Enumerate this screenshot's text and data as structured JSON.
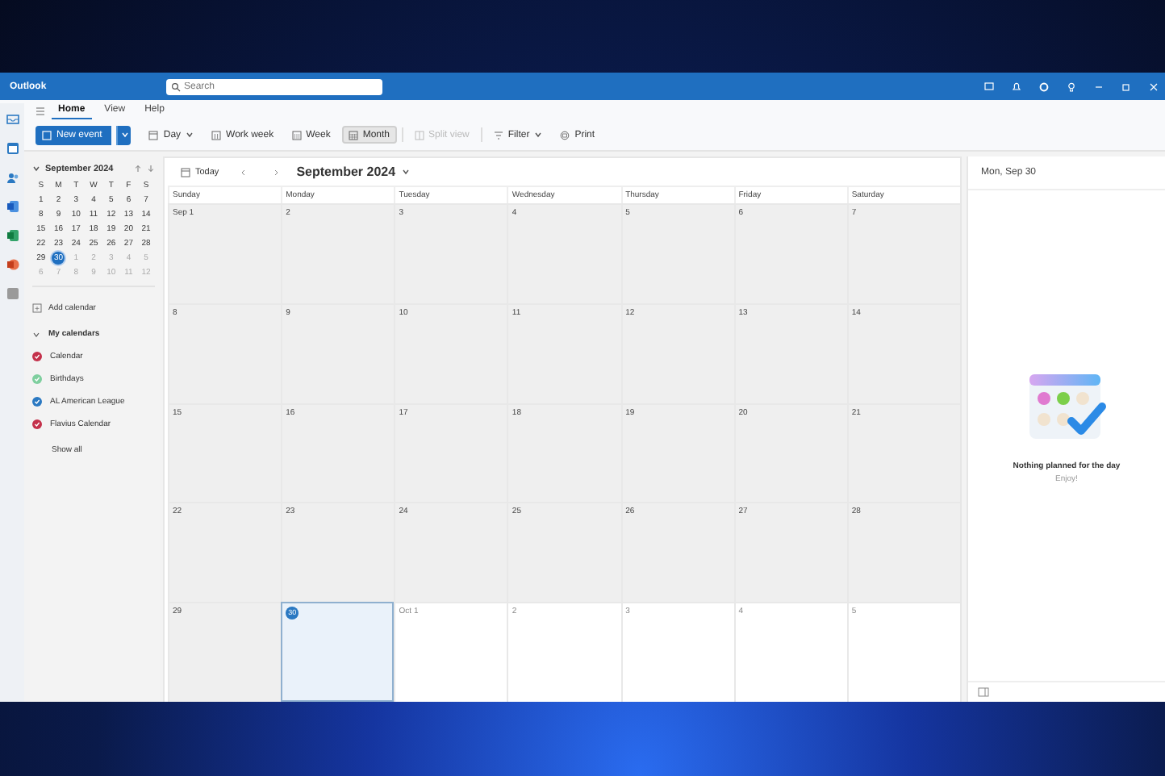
{
  "window": {
    "title": "Outlook"
  },
  "search": {
    "placeholder": "Search"
  },
  "ribbon_tabs": [
    {
      "label": "Home",
      "selected": true
    },
    {
      "label": "View",
      "selected": false
    },
    {
      "label": "Help",
      "selected": false
    }
  ],
  "toolbar": {
    "new_event": "New event",
    "views": [
      {
        "kind": "day",
        "label": "Day",
        "selected": false,
        "disabled": false,
        "dropdown": true
      },
      {
        "kind": "workweek",
        "label": "Work week",
        "selected": false,
        "disabled": false,
        "dropdown": false
      },
      {
        "kind": "week",
        "label": "Week",
        "selected": false,
        "disabled": false,
        "dropdown": false
      },
      {
        "kind": "month",
        "label": "Month",
        "selected": true,
        "disabled": false,
        "dropdown": false
      },
      {
        "kind": "split",
        "label": "Split view",
        "selected": false,
        "disabled": true,
        "dropdown": false
      },
      {
        "kind": "filter",
        "label": "Filter",
        "selected": false,
        "disabled": false,
        "dropdown": true
      },
      {
        "kind": "print",
        "label": "Print",
        "selected": false,
        "disabled": false,
        "dropdown": false
      }
    ]
  },
  "mini_calendar": {
    "title": "September 2024",
    "weekdays": [
      "S",
      "M",
      "T",
      "W",
      "T",
      "F",
      "S"
    ],
    "weeks": [
      [
        {
          "label": "1",
          "in_month": true,
          "selected": false
        },
        {
          "label": "2",
          "in_month": true,
          "selected": false
        },
        {
          "label": "3",
          "in_month": true,
          "selected": false
        },
        {
          "label": "4",
          "in_month": true,
          "selected": false
        },
        {
          "label": "5",
          "in_month": true,
          "selected": false
        },
        {
          "label": "6",
          "in_month": true,
          "selected": false
        },
        {
          "label": "7",
          "in_month": true,
          "selected": false
        }
      ],
      [
        {
          "label": "8",
          "in_month": true,
          "selected": false
        },
        {
          "label": "9",
          "in_month": true,
          "selected": false
        },
        {
          "label": "10",
          "in_month": true,
          "selected": false
        },
        {
          "label": "11",
          "in_month": true,
          "selected": false
        },
        {
          "label": "12",
          "in_month": true,
          "selected": false
        },
        {
          "label": "13",
          "in_month": true,
          "selected": false
        },
        {
          "label": "14",
          "in_month": true,
          "selected": false
        }
      ],
      [
        {
          "label": "15",
          "in_month": true,
          "selected": false
        },
        {
          "label": "16",
          "in_month": true,
          "selected": false
        },
        {
          "label": "17",
          "in_month": true,
          "selected": false
        },
        {
          "label": "18",
          "in_month": true,
          "selected": false
        },
        {
          "label": "19",
          "in_month": true,
          "selected": false
        },
        {
          "label": "20",
          "in_month": true,
          "selected": false
        },
        {
          "label": "21",
          "in_month": true,
          "selected": false
        }
      ],
      [
        {
          "label": "22",
          "in_month": true,
          "selected": false
        },
        {
          "label": "23",
          "in_month": true,
          "selected": false
        },
        {
          "label": "24",
          "in_month": true,
          "selected": false
        },
        {
          "label": "25",
          "in_month": true,
          "selected": false
        },
        {
          "label": "26",
          "in_month": true,
          "selected": false
        },
        {
          "label": "27",
          "in_month": true,
          "selected": false
        },
        {
          "label": "28",
          "in_month": true,
          "selected": false
        }
      ],
      [
        {
          "label": "29",
          "in_month": true,
          "selected": false
        },
        {
          "label": "30",
          "in_month": true,
          "selected": true
        },
        {
          "label": "1",
          "in_month": false,
          "selected": false
        },
        {
          "label": "2",
          "in_month": false,
          "selected": false
        },
        {
          "label": "3",
          "in_month": false,
          "selected": false
        },
        {
          "label": "4",
          "in_month": false,
          "selected": false
        },
        {
          "label": "5",
          "in_month": false,
          "selected": false
        }
      ],
      [
        {
          "label": "6",
          "in_month": false,
          "selected": false
        },
        {
          "label": "7",
          "in_month": false,
          "selected": false
        },
        {
          "label": "8",
          "in_month": false,
          "selected": false
        },
        {
          "label": "9",
          "in_month": false,
          "selected": false
        },
        {
          "label": "10",
          "in_month": false,
          "selected": false
        },
        {
          "label": "11",
          "in_month": false,
          "selected": false
        },
        {
          "label": "12",
          "in_month": false,
          "selected": false
        }
      ]
    ]
  },
  "sidebar": {
    "add_calendar": "Add calendar",
    "group": {
      "label": "My calendars",
      "expanded": true
    },
    "calendars": [
      {
        "name": "Calendar",
        "color": "#c4314b",
        "checked": true
      },
      {
        "name": "Birthdays",
        "color": "#7fcf9f",
        "checked": true
      },
      {
        "name": "AL American League",
        "color": "#2b79c2",
        "checked": true
      },
      {
        "name": "Flavius Calendar",
        "color": "#c4314b",
        "checked": true
      }
    ],
    "show_all": "Show all"
  },
  "month_view": {
    "today_button": "Today",
    "title": "September 2024",
    "weekdays": [
      "Sunday",
      "Monday",
      "Tuesday",
      "Wednesday",
      "Thursday",
      "Friday",
      "Saturday"
    ],
    "weeks": [
      [
        {
          "label": "Sep 1",
          "in_month": true,
          "selected": false
        },
        {
          "label": "2",
          "in_month": true,
          "selected": false
        },
        {
          "label": "3",
          "in_month": true,
          "selected": false
        },
        {
          "label": "4",
          "in_month": true,
          "selected": false
        },
        {
          "label": "5",
          "in_month": true,
          "selected": false
        },
        {
          "label": "6",
          "in_month": true,
          "selected": false
        },
        {
          "label": "7",
          "in_month": true,
          "selected": false
        }
      ],
      [
        {
          "label": "8",
          "in_month": true,
          "selected": false
        },
        {
          "label": "9",
          "in_month": true,
          "selected": false
        },
        {
          "label": "10",
          "in_month": true,
          "selected": false
        },
        {
          "label": "11",
          "in_month": true,
          "selected": false
        },
        {
          "label": "12",
          "in_month": true,
          "selected": false
        },
        {
          "label": "13",
          "in_month": true,
          "selected": false
        },
        {
          "label": "14",
          "in_month": true,
          "selected": false
        }
      ],
      [
        {
          "label": "15",
          "in_month": true,
          "selected": false
        },
        {
          "label": "16",
          "in_month": true,
          "selected": false
        },
        {
          "label": "17",
          "in_month": true,
          "selected": false
        },
        {
          "label": "18",
          "in_month": true,
          "selected": false
        },
        {
          "label": "19",
          "in_month": true,
          "selected": false
        },
        {
          "label": "20",
          "in_month": true,
          "selected": false
        },
        {
          "label": "21",
          "in_month": true,
          "selected": false
        }
      ],
      [
        {
          "label": "22",
          "in_month": true,
          "selected": false
        },
        {
          "label": "23",
          "in_month": true,
          "selected": false
        },
        {
          "label": "24",
          "in_month": true,
          "selected": false
        },
        {
          "label": "25",
          "in_month": true,
          "selected": false
        },
        {
          "label": "26",
          "in_month": true,
          "selected": false
        },
        {
          "label": "27",
          "in_month": true,
          "selected": false
        },
        {
          "label": "28",
          "in_month": true,
          "selected": false
        }
      ],
      [
        {
          "label": "29",
          "in_month": true,
          "selected": false
        },
        {
          "label": "30",
          "in_month": true,
          "selected": true
        },
        {
          "label": "Oct 1",
          "in_month": false,
          "selected": false
        },
        {
          "label": "2",
          "in_month": false,
          "selected": false
        },
        {
          "label": "3",
          "in_month": false,
          "selected": false
        },
        {
          "label": "4",
          "in_month": false,
          "selected": false
        },
        {
          "label": "5",
          "in_month": false,
          "selected": false
        }
      ]
    ]
  },
  "day_panel": {
    "title": "Mon, Sep 30",
    "empty_title": "Nothing planned for the day",
    "empty_subtitle": "Enjoy!"
  }
}
